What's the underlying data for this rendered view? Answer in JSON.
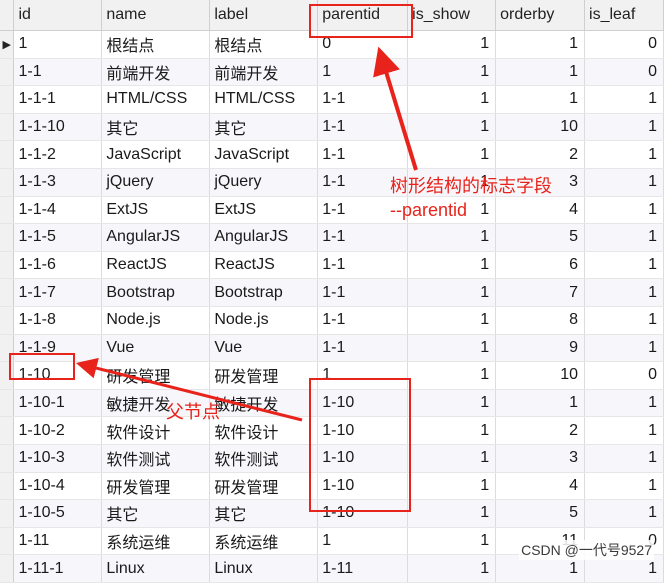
{
  "columns": [
    "id",
    "name",
    "label",
    "parentid",
    "is_show",
    "orderby",
    "is_leaf"
  ],
  "current_row_marker": "▶",
  "rows": [
    [
      "1",
      "根结点",
      "根结点",
      "0",
      "1",
      "1",
      "0"
    ],
    [
      "1-1",
      "前端开发",
      "前端开发",
      "1",
      "1",
      "1",
      "0"
    ],
    [
      "1-1-1",
      "HTML/CSS",
      "HTML/CSS",
      "1-1",
      "1",
      "1",
      "1"
    ],
    [
      "1-1-10",
      "其它",
      "其它",
      "1-1",
      "1",
      "10",
      "1"
    ],
    [
      "1-1-2",
      "JavaScript",
      "JavaScript",
      "1-1",
      "1",
      "2",
      "1"
    ],
    [
      "1-1-3",
      "jQuery",
      "jQuery",
      "1-1",
      "1",
      "3",
      "1"
    ],
    [
      "1-1-4",
      "ExtJS",
      "ExtJS",
      "1-1",
      "1",
      "4",
      "1"
    ],
    [
      "1-1-5",
      "AngularJS",
      "AngularJS",
      "1-1",
      "1",
      "5",
      "1"
    ],
    [
      "1-1-6",
      "ReactJS",
      "ReactJS",
      "1-1",
      "1",
      "6",
      "1"
    ],
    [
      "1-1-7",
      "Bootstrap",
      "Bootstrap",
      "1-1",
      "1",
      "7",
      "1"
    ],
    [
      "1-1-8",
      "Node.js",
      "Node.js",
      "1-1",
      "1",
      "8",
      "1"
    ],
    [
      "1-1-9",
      "Vue",
      "Vue",
      "1-1",
      "1",
      "9",
      "1"
    ],
    [
      "1-10",
      "研发管理",
      "研发管理",
      "1",
      "1",
      "10",
      "0"
    ],
    [
      "1-10-1",
      "敏捷开发",
      "敏捷开发",
      "1-10",
      "1",
      "1",
      "1"
    ],
    [
      "1-10-2",
      "软件设计",
      "软件设计",
      "1-10",
      "1",
      "2",
      "1"
    ],
    [
      "1-10-3",
      "软件测试",
      "软件测试",
      "1-10",
      "1",
      "3",
      "1"
    ],
    [
      "1-10-4",
      "研发管理",
      "研发管理",
      "1-10",
      "1",
      "4",
      "1"
    ],
    [
      "1-10-5",
      "其它",
      "其它",
      "1-10",
      "1",
      "5",
      "1"
    ],
    [
      "1-11",
      "系统运维",
      "系统运维",
      "1",
      "1",
      "11",
      "0"
    ],
    [
      "1-11-1",
      "Linux",
      "Linux",
      "1-11",
      "1",
      "1",
      "1"
    ]
  ],
  "annotations": {
    "tree_field_line1": "树形结构的标志字段",
    "tree_field_line2": "--parentid",
    "parent_node": "父节点"
  },
  "watermark": "CSDN @一代号9527",
  "colors": {
    "annotation_red": "#e8231b",
    "header_bg": "#f1f1f1",
    "alt_row_bg": "#f7f7fb"
  }
}
